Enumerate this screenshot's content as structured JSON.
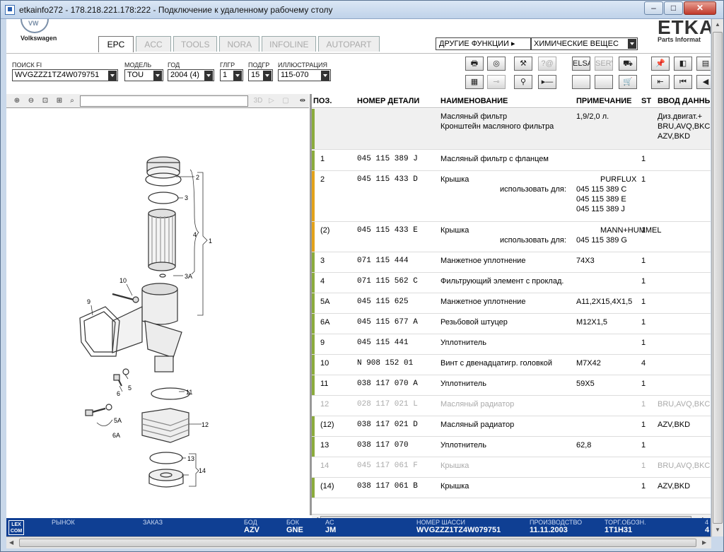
{
  "window": {
    "title": "etkainfo272 - 178.218.221.178:222 - Подключение к удаленному рабочему столу",
    "min": "–",
    "max": "□",
    "close": "✕"
  },
  "header": {
    "brand": "Volkswagen",
    "tabs": [
      {
        "label": "EPC",
        "active": true
      },
      {
        "label": "ACC",
        "active": false
      },
      {
        "label": "TOOLS",
        "active": false
      },
      {
        "label": "NORA",
        "active": false
      },
      {
        "label": "INFOLINE",
        "active": false
      },
      {
        "label": "AUTOPART",
        "active": false
      }
    ],
    "functions_label": "ДРУГИЕ ФУНКЦИИ ▸",
    "functions_value": "ХИМИЧЕСКИЕ ВЕЩЕС",
    "logo_text": "ETKA",
    "logo_sub": "Parts Informat"
  },
  "filters": {
    "vin": {
      "label": "ПОИСК FI",
      "value": "WVGZZZ1TZ4W079751"
    },
    "model": {
      "label": "МОДЕЛЬ",
      "value": "TOU"
    },
    "year": {
      "label": "ГОД",
      "value": "2004 (4)"
    },
    "main_group": {
      "label": "ГЛГР",
      "value": "1"
    },
    "sub_group": {
      "label": "ПОДГР",
      "value": "15"
    },
    "illustration": {
      "label": "ИЛЛЮСТРАЦИЯ",
      "value": "115-070"
    }
  },
  "toolbar": {
    "row1": [
      "🖶",
      "◎",
      "⚒",
      "?@",
      "ELSA",
      "SERVICE",
      "⛟",
      "📌",
      "◧",
      "▤"
    ],
    "row2": [
      "▦",
      "⊸",
      "⚲",
      "▸—",
      "",
      "",
      "🛒",
      "⇤",
      "⏮",
      "◀"
    ]
  },
  "diagram_toolbar": {
    "btn_3d": "3D"
  },
  "diagram": {
    "callouts": [
      "1",
      "2",
      "3",
      "3A",
      "4",
      "5",
      "5A",
      "6",
      "6A",
      "9",
      "10",
      "11",
      "12",
      "13",
      "14"
    ]
  },
  "list": {
    "headers": {
      "pos": "ПОЗ.",
      "part": "НОМЕР ДЕТАЛИ",
      "name": "НАИМЕНОВАНИЕ",
      "note": "ПРИМЕЧАНИЕ",
      "st": "ST",
      "input": "ВВОД ДАННЫ"
    },
    "group_header": {
      "names": [
        "Масляный фильтр",
        "Кронштейн масляного фильтра"
      ],
      "note": "1,9/2,0 л.",
      "input": [
        "Диз.двигат.+",
        "BRU,AVQ,BKC,",
        "AZV,BKD"
      ]
    },
    "rows": [
      {
        "pos": "1",
        "part": "045  115  389  J",
        "name": "Масляный фильтр с фланцем",
        "note": "",
        "st": "1",
        "input": "",
        "color": "#8bab3d",
        "grey": false,
        "extra": []
      },
      {
        "pos": "2",
        "part": "045  115  433  D",
        "name": "Крышка",
        "note": "PURFLUX",
        "st": "1",
        "input": "",
        "color": "#e3a21a",
        "grey": false,
        "extra": [
          "использовать для:",
          "045 115 389 C",
          "045 115 389 E",
          "045 115 389 J"
        ]
      },
      {
        "pos": "(2)",
        "part": "045  115  433  E",
        "name": "Крышка",
        "note": "MANN+HUMMEL",
        "st": "1",
        "input": "",
        "color": "#e3a21a",
        "grey": false,
        "extra": [
          "использовать для:",
          "045 115 389 G"
        ]
      },
      {
        "pos": "3",
        "part": "071  115  444",
        "name": "Манжетное уплотнение",
        "note": "74X3",
        "st": "1",
        "input": "",
        "color": "#8bab3d",
        "grey": false,
        "extra": []
      },
      {
        "pos": "4",
        "part": "071  115  562  C",
        "name": "Фильтрующий элемент с проклад.",
        "note": "",
        "st": "1",
        "input": "",
        "color": "#8bab3d",
        "grey": false,
        "extra": []
      },
      {
        "pos": "5A",
        "part": "045  115  625",
        "name": "Манжетное уплотнение",
        "note": "A11,2X15,4X1,5",
        "st": "1",
        "input": "",
        "color": "#8bab3d",
        "grey": false,
        "extra": []
      },
      {
        "pos": "6A",
        "part": "045  115  677  A",
        "name": "Резьбовой штуцер",
        "note": "M12X1,5",
        "st": "1",
        "input": "",
        "color": "#8bab3d",
        "grey": false,
        "extra": []
      },
      {
        "pos": "9",
        "part": "045  115  441",
        "name": "Уплотнитель",
        "note": "",
        "st": "1",
        "input": "",
        "color": "#8bab3d",
        "grey": false,
        "extra": []
      },
      {
        "pos": "10",
        "part": "N    908  152  01",
        "name": "Винт с двенадцатигр. головкой",
        "note": "M7X42",
        "st": "4",
        "input": "",
        "color": "#8bab3d",
        "grey": false,
        "extra": []
      },
      {
        "pos": "11",
        "part": "038  117  070  A",
        "name": "Уплотнитель",
        "note": "59X5",
        "st": "1",
        "input": "",
        "color": "#8bab3d",
        "grey": false,
        "extra": []
      },
      {
        "pos": "12",
        "part": "028  117  021  L",
        "name": "Масляный радиатор",
        "note": "",
        "st": "1",
        "input": "BRU,AVQ,BKC",
        "color": "",
        "grey": true,
        "extra": []
      },
      {
        "pos": "(12)",
        "part": "038  117  021  D",
        "name": "Масляный радиатор",
        "note": "",
        "st": "1",
        "input": "AZV,BKD",
        "color": "#8bab3d",
        "grey": false,
        "extra": []
      },
      {
        "pos": "13",
        "part": "038  117  070",
        "name": "Уплотнитель",
        "note": "62,8",
        "st": "1",
        "input": "",
        "color": "#8bab3d",
        "grey": false,
        "extra": []
      },
      {
        "pos": "14",
        "part": "045  117  061  F",
        "name": "Крышка",
        "note": "",
        "st": "1",
        "input": "BRU,AVQ,BKC",
        "color": "",
        "grey": true,
        "extra": []
      },
      {
        "pos": "(14)",
        "part": "038  117  061  B",
        "name": "Крышка",
        "note": "",
        "st": "1",
        "input": "AZV,BKD",
        "color": "#8bab3d",
        "grey": false,
        "extra": []
      }
    ]
  },
  "status": {
    "logo": "LEX COM",
    "market": {
      "key": "РЫНОК",
      "value": ""
    },
    "order": {
      "key": "ЗАКАЗ",
      "value": ""
    },
    "bod": {
      "key": "БОД",
      "value": "AZV"
    },
    "bok": {
      "key": "БОК",
      "value": "GNE"
    },
    "ac": {
      "key": "AC",
      "value": "JM"
    },
    "chassis": {
      "key": "НОМЕР ШАССИ",
      "value": "WVGZZZ1TZ4W079751"
    },
    "production": {
      "key": "ПРОИЗВОДСТВО",
      "value": "11.11.2003"
    },
    "trade": {
      "key": "ТОРГ.ОБОЗН.",
      "value": "1T1H31"
    },
    "last": {
      "key": "4",
      "value": "4"
    }
  }
}
